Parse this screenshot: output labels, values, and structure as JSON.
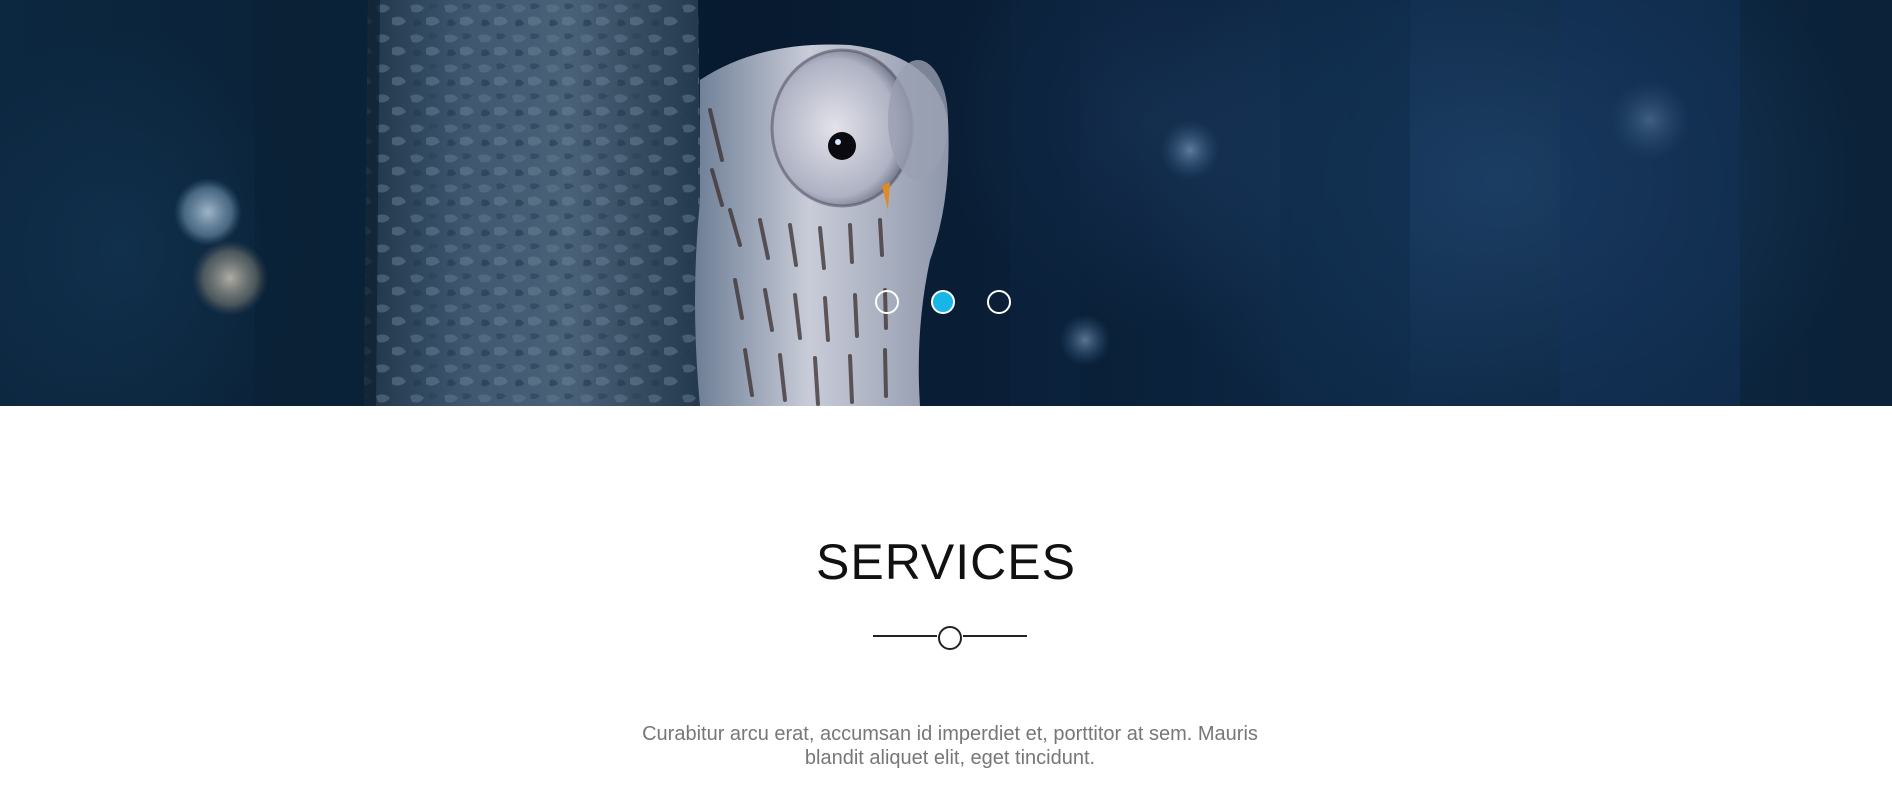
{
  "hero": {
    "image_icon": "owl-photo",
    "slides": [
      {
        "label": "Slide 1",
        "active": false
      },
      {
        "label": "Slide 2",
        "active": true
      },
      {
        "label": "Slide 3",
        "active": false
      }
    ],
    "accent_color": "#18b6e6"
  },
  "services": {
    "title": "SERVICES",
    "description": "Curabitur arcu erat, accumsan id imperdiet et, porttitor at sem. Mauris blandit aliquet elit, eget tincidunt."
  }
}
